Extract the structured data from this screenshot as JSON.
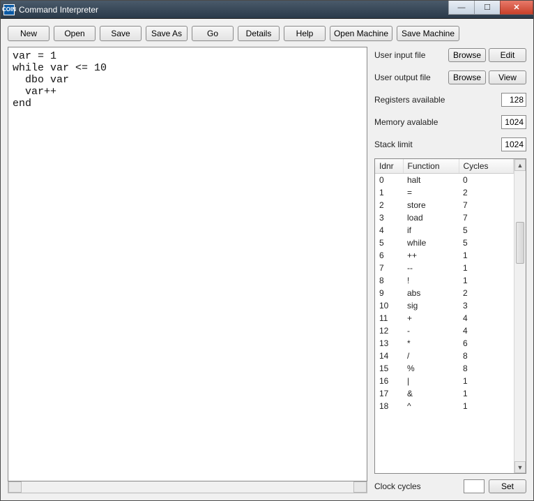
{
  "titlebar": {
    "icon_text": "COIN",
    "title": "Command Interpreter"
  },
  "toolbar": {
    "new": "New",
    "open": "Open",
    "save": "Save",
    "saveas": "Save As",
    "go": "Go",
    "details": "Details",
    "help": "Help",
    "open_machine": "Open Machine",
    "save_machine": "Save Machine"
  },
  "editor": {
    "content": "var = 1\nwhile var <= 10\n  dbo var\n  var++\nend"
  },
  "side": {
    "user_input_label": "User input file",
    "user_output_label": "User output file",
    "browse": "Browse",
    "edit": "Edit",
    "view": "View",
    "registers_label": "Registers available",
    "registers_value": "128",
    "memory_label": "Memory avalable",
    "memory_value": "1024",
    "stack_label": "Stack limit",
    "stack_value": "1024",
    "clock_label": "Clock cycles",
    "clock_value": "",
    "set": "Set"
  },
  "table": {
    "headers": {
      "id": "Idnr",
      "func": "Function",
      "cycles": "Cycles"
    },
    "rows": [
      {
        "id": "0",
        "func": "halt",
        "cycles": "0"
      },
      {
        "id": "1",
        "func": "=",
        "cycles": "2"
      },
      {
        "id": "2",
        "func": "store",
        "cycles": "7"
      },
      {
        "id": "3",
        "func": "load",
        "cycles": "7"
      },
      {
        "id": "4",
        "func": "if",
        "cycles": "5"
      },
      {
        "id": "5",
        "func": "while",
        "cycles": "5"
      },
      {
        "id": "6",
        "func": "++",
        "cycles": "1"
      },
      {
        "id": "7",
        "func": "--",
        "cycles": "1"
      },
      {
        "id": "8",
        "func": "!",
        "cycles": "1"
      },
      {
        "id": "9",
        "func": "abs",
        "cycles": "2"
      },
      {
        "id": "10",
        "func": "sig",
        "cycles": "3"
      },
      {
        "id": "11",
        "func": "+",
        "cycles": "4"
      },
      {
        "id": "12",
        "func": "-",
        "cycles": "4"
      },
      {
        "id": "13",
        "func": "*",
        "cycles": "6"
      },
      {
        "id": "14",
        "func": "/",
        "cycles": "8"
      },
      {
        "id": "15",
        "func": "%",
        "cycles": "8"
      },
      {
        "id": "16",
        "func": "|",
        "cycles": "1"
      },
      {
        "id": "17",
        "func": "&",
        "cycles": "1"
      },
      {
        "id": "18",
        "func": "^",
        "cycles": "1"
      }
    ]
  }
}
